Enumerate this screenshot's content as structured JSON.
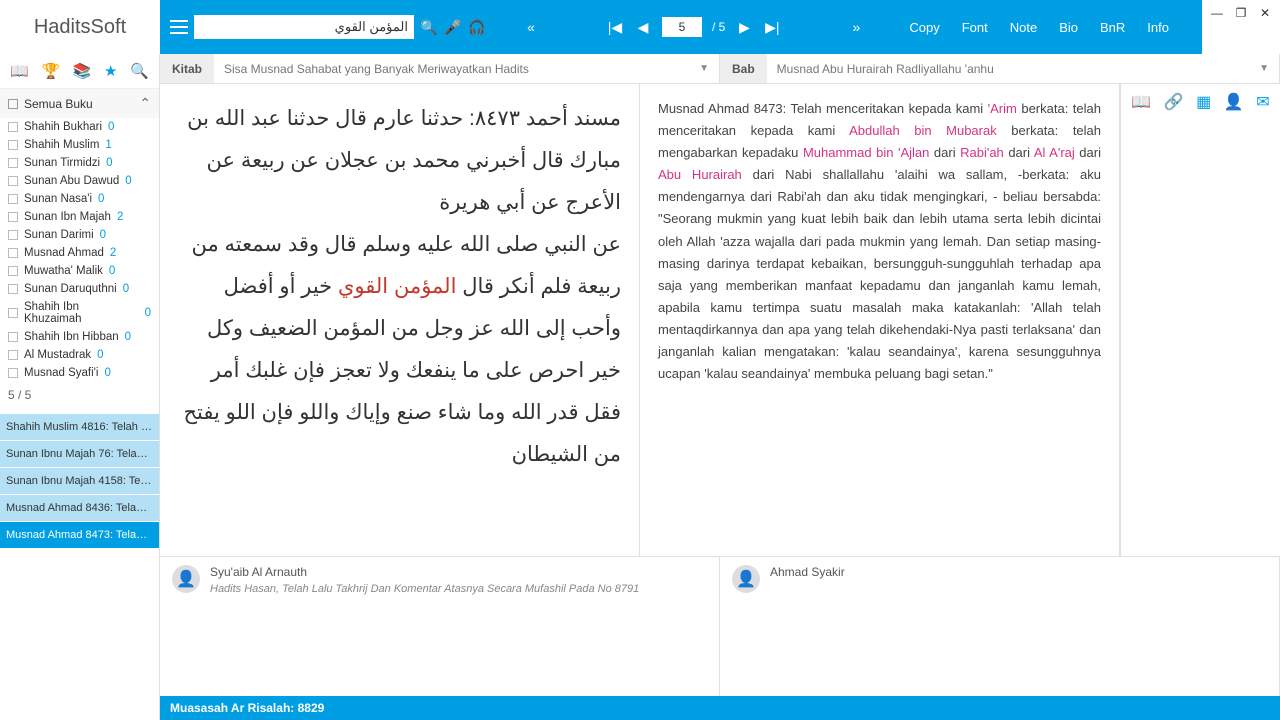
{
  "logo": "HaditsSoft",
  "search": {
    "value": "المؤمن القوي"
  },
  "nav": {
    "page": "5",
    "total": "/ 5"
  },
  "toolbar": {
    "copy": "Copy",
    "font": "Font",
    "note": "Note",
    "bio": "Bio",
    "bnr": "BnR",
    "info": "Info"
  },
  "sidebar": {
    "header": "Semua Buku",
    "books": [
      {
        "name": "Shahih Bukhari",
        "count": "0"
      },
      {
        "name": "Shahih Muslim",
        "count": "1"
      },
      {
        "name": "Sunan Tirmidzi",
        "count": "0"
      },
      {
        "name": "Sunan Abu Dawud",
        "count": "0"
      },
      {
        "name": "Sunan Nasa'i",
        "count": "0"
      },
      {
        "name": "Sunan Ibn Majah",
        "count": "2"
      },
      {
        "name": "Sunan Darimi",
        "count": "0"
      },
      {
        "name": "Musnad Ahmad",
        "count": "2"
      },
      {
        "name": "Muwatha' Malik",
        "count": "0"
      },
      {
        "name": "Sunan Daruquthni",
        "count": "0"
      },
      {
        "name": "Shahih Ibn Khuzaimah",
        "count": "0"
      },
      {
        "name": "Shahih Ibn Hibban",
        "count": "0"
      },
      {
        "name": "Al Mustadrak",
        "count": "0"
      },
      {
        "name": "Musnad Syafi'i",
        "count": "0"
      }
    ],
    "pager": "5   /  5",
    "results": [
      "Shahih Muslim 4816: Telah menc...",
      "Sunan Ibnu Majah 76: Telah men...",
      "Sunan Ibnu Majah 4158: Telah m...",
      "Musnad Ahmad 8436: Telah men...",
      "Musnad Ahmad 8473: Telah men..."
    ],
    "selected": 4
  },
  "dropdowns": {
    "kitab_label": "Kitab",
    "kitab_val": "Sisa Musnad Sahabat yang Banyak Meriwayatkan Hadits",
    "bab_label": "Bab",
    "bab_val": "Musnad Abu Hurairah Radliyallahu 'anhu"
  },
  "arabic": {
    "line1": "مسند أحمد ٨٤٧٣: حدثنا عارم قال حدثنا عبد الله بن مبارك قال أخبرني محمد بن عجلان عن ربيعة عن الأعرج عن أبي هريرة",
    "line2_a": "عن النبي صلى الله عليه وسلم قال وقد سمعته من ربيعة فلم أنكر قال ",
    "line2_hl": "المؤمن القوي",
    "line2_b": " خير أو أفضل وأحب إلى الله عز وجل من المؤمن الضعيف وكل خير احرص على ما ينفعك ولا تعجز فإن غلبك أمر فقل قدر الله وما شاء صنع وإياك واللو فإن اللو يفتح من الشيطان"
  },
  "trans": {
    "p1": "Musnad Ahmad 8473: Telah menceritakan kepada kami ",
    "n1": "'Arim",
    "p2": " berkata: telah menceritakan kepada kami ",
    "n2": "Abdullah bin Mubarak",
    "p3": " berkata: telah mengabarkan kepadaku ",
    "n3": "Muhammad bin 'Ajlan",
    "p4": " dari ",
    "n4": "Rabi'ah",
    "p5": " dari ",
    "n5": "Al A'raj",
    "p6": " dari ",
    "n6": "Abu Hurairah",
    "p7": " dari Nabi shallallahu 'alaihi wa sallam, -berkata: aku mendengarnya dari Rabi'ah dan aku tidak mengingkari, - beliau bersabda: \"Seorang mukmin yang kuat lebih baik dan lebih utama serta lebih dicintai oleh Allah 'azza wajalla dari pada mukmin yang lemah. Dan setiap masing-masing darinya terdapat kebaikan, bersungguh-sungguhlah terhadap apa saja yang memberikan manfaat kepadamu dan janganlah kamu lemah, apabila kamu tertimpa suatu masalah maka katakanlah: 'Allah telah mentaqdirkannya dan apa yang telah dikehendaki-Nya pasti terlaksana' dan janganlah kalian mengatakan: 'kalau seandainya', karena sesungguhnya ucapan 'kalau seandainya' membuka peluang bagi setan.\""
  },
  "comm": {
    "c1_name": "Syu'aib Al Arnauth",
    "c1_text": "Hadits Hasan, Telah Lalu Takhrij Dan Komentar Atasnya Secara Mufashil Pada No 8791",
    "c2_name": "Ahmad Syakir"
  },
  "footer": "Muasasah Ar Risalah:   8829"
}
